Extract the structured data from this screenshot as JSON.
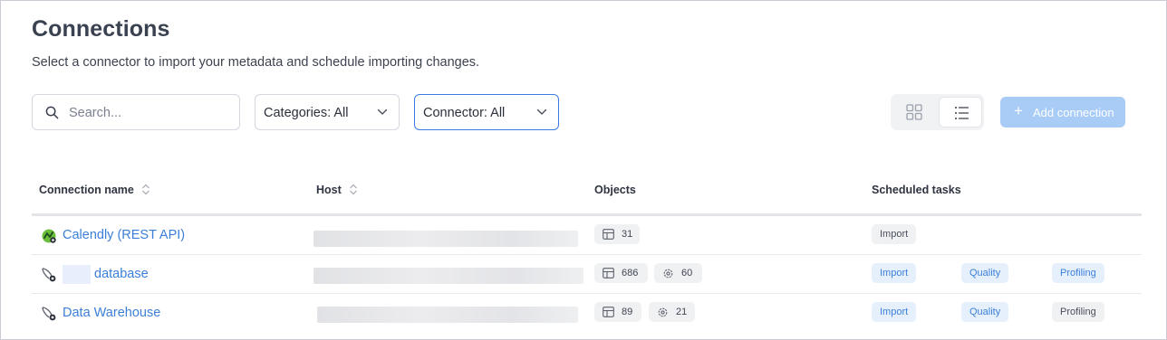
{
  "page": {
    "title": "Connections",
    "subtitle": "Select a connector to import your metadata and schedule importing changes."
  },
  "toolbar": {
    "search_placeholder": "Search...",
    "categories_label": "Categories: All",
    "connector_label": "Connector: All",
    "add_connection_label": "Add connection"
  },
  "table": {
    "headers": {
      "name": "Connection name",
      "host": "Host",
      "objects": "Objects",
      "tasks": "Scheduled tasks"
    },
    "rows": [
      {
        "name": "Calendly (REST API)",
        "icon": "calendly-connector-icon",
        "host": "",
        "objects": {
          "tables": "31"
        },
        "tasks": [
          {
            "label": "Import",
            "status": "inactive"
          }
        ]
      },
      {
        "name": "database",
        "icon": "db-connector-icon",
        "host": "",
        "objects": {
          "tables": "686",
          "checks": "60"
        },
        "tasks": [
          {
            "label": "Import",
            "status": "active"
          },
          {
            "label": "Quality",
            "status": "active"
          },
          {
            "label": "Profiling",
            "status": "active"
          }
        ]
      },
      {
        "name": "Data Warehouse",
        "icon": "db-connector-icon",
        "host": "",
        "objects": {
          "tables": "89",
          "checks": "21"
        },
        "tasks": [
          {
            "label": "Import",
            "status": "active"
          },
          {
            "label": "Quality",
            "status": "active"
          },
          {
            "label": "Profiling",
            "status": "inactive"
          }
        ]
      }
    ]
  },
  "colors": {
    "accent": "#3b7fd9",
    "active_task_bg": "#e6f0fd",
    "inactive_task_bg": "#f0f1f3",
    "add_button_disabled": "#a9ccf7"
  }
}
